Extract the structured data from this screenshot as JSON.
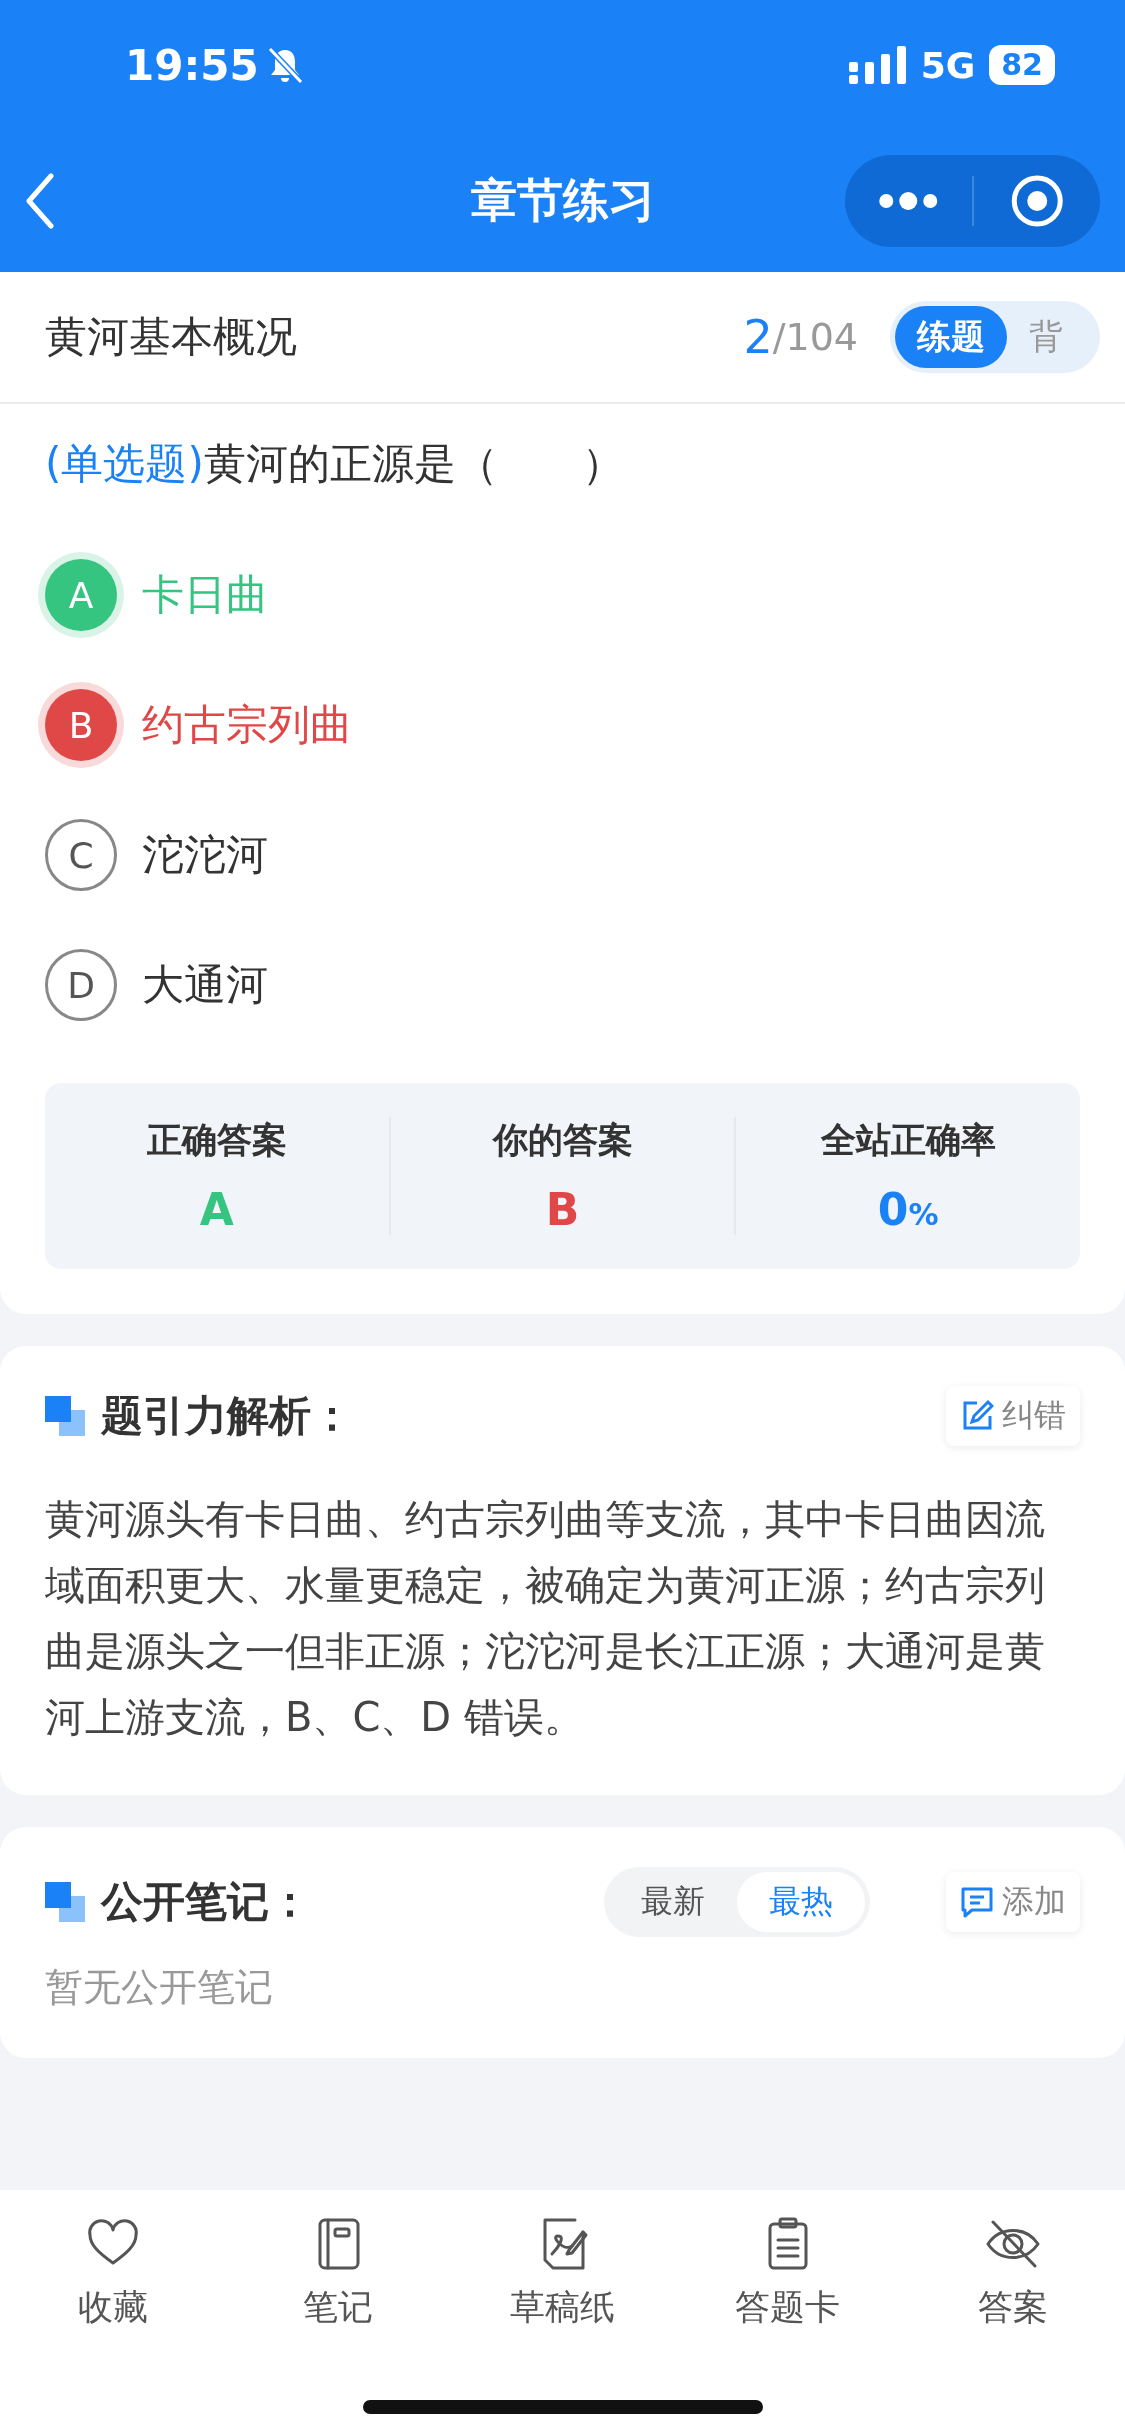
{
  "status_bar": {
    "time": "19:55",
    "network": "5G",
    "battery": "82"
  },
  "nav_bar": {
    "title": "章节练习"
  },
  "header": {
    "title": "黄河基本概况",
    "current": "2",
    "total": "/104",
    "modes": [
      {
        "label": "练题",
        "selected": true
      },
      {
        "label": "背",
        "selected": false
      }
    ]
  },
  "question": {
    "type": "(单选题)",
    "text": "黄河的正源是（　　）",
    "options": [
      {
        "letter": "A",
        "text": "卡日曲",
        "kind": "correct"
      },
      {
        "letter": "B",
        "text": "约古宗列曲",
        "kind": "wrong"
      },
      {
        "letter": "C",
        "text": "沱沱河",
        "kind": "plain"
      },
      {
        "letter": "D",
        "text": "大通河",
        "kind": "plain"
      }
    ]
  },
  "stats": [
    {
      "label": "正确答案",
      "value": "A",
      "kind": "correct"
    },
    {
      "label": "你的答案",
      "value": "B",
      "kind": "wrong"
    },
    {
      "label": "全站正确率",
      "value": "0",
      "unit": "%",
      "kind": "rate"
    }
  ],
  "analysis": {
    "title": "题引力解析：",
    "action": "纠错",
    "text": "黄河源头有卡日曲、约古宗列曲等支流，其中卡日曲因流域面积更大、水量更稳定，被确定为黄河正源；约古宗列曲是源头之一但非正源；沱沱河是长江正源；大通河是黄河上游支流，B、C、D 错误。"
  },
  "notes": {
    "title": "公开笔记：",
    "sorts": [
      {
        "label": "最新",
        "selected": false
      },
      {
        "label": "最热",
        "selected": true
      }
    ],
    "action": "添加",
    "empty": "暂无公开笔记"
  },
  "bottom_bar": [
    {
      "kind": "heart",
      "label": "收藏"
    },
    {
      "kind": "notebook",
      "label": "笔记"
    },
    {
      "kind": "draft",
      "label": "草稿纸"
    },
    {
      "kind": "clipboard",
      "label": "答题卡"
    },
    {
      "kind": "eye",
      "label": "答案"
    }
  ]
}
